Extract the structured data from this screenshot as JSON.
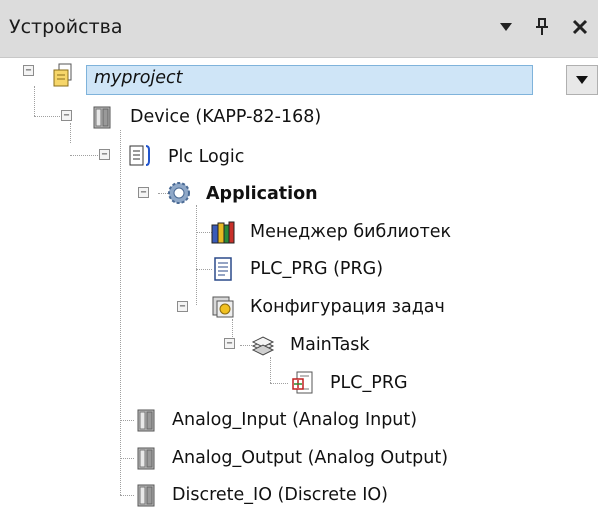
{
  "panel": {
    "title": "Устройства",
    "dropdown_glyph": "▼",
    "pin_glyph": "ᵖ",
    "close_glyph": "✕"
  },
  "tree": {
    "project": "myproject",
    "device": "Device (KAPP-82-168)",
    "plc_logic": "Plc Logic",
    "application": "Application",
    "library_manager": "Менеджер библиотек",
    "plc_prg": "PLC_PRG (PRG)",
    "task_config": "Конфигурация задач",
    "main_task": "MainTask",
    "task_plc_prg": "PLC_PRG",
    "analog_input": "Analog_Input (Analog Input)",
    "analog_output": "Analog_Output (Analog Output)",
    "discrete_io": "Discrete_IO (Discrete IO)"
  },
  "scroll_dropdown_glyph": "▼",
  "colors": {
    "header_bg": "#dcdcdc",
    "selection_bg": "#cfe5f7"
  }
}
